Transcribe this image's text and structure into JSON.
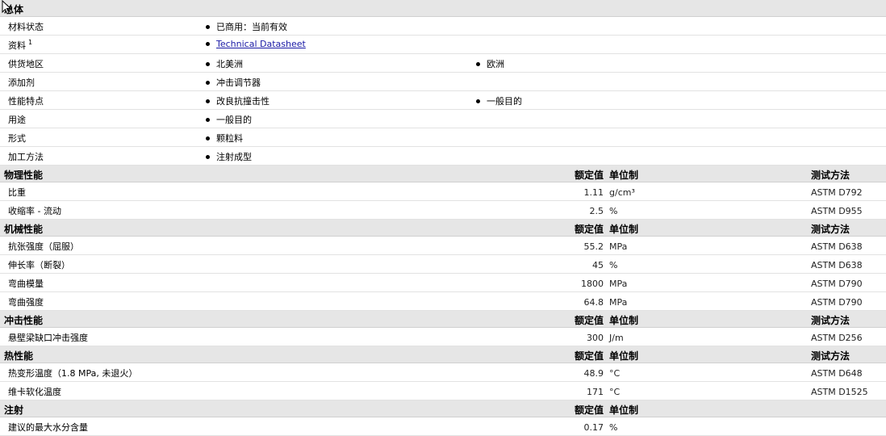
{
  "general": {
    "title": "总体",
    "rows": [
      {
        "label": "材料状态",
        "sup": "",
        "items": [
          "已商用：当前有效"
        ]
      },
      {
        "label": "资料",
        "sup": "1",
        "items": [
          "Technical Datasheet"
        ],
        "link": true
      },
      {
        "label": "供货地区",
        "sup": "",
        "items": [
          "北美洲",
          "欧洲"
        ]
      },
      {
        "label": "添加剂",
        "sup": "",
        "items": [
          "冲击调节器"
        ]
      },
      {
        "label": "性能特点",
        "sup": "",
        "items": [
          "改良抗撞击性",
          "一般目的"
        ]
      },
      {
        "label": "用途",
        "sup": "",
        "items": [
          "一般目的"
        ]
      },
      {
        "label": "形式",
        "sup": "",
        "items": [
          "颗粒料"
        ]
      },
      {
        "label": "加工方法",
        "sup": "",
        "items": [
          "注射成型"
        ]
      }
    ]
  },
  "headers": {
    "value": "额定值",
    "unit": "单位制",
    "method": "测试方法"
  },
  "sections": [
    {
      "title": "物理性能",
      "show_method": true,
      "rows": [
        {
          "label": "比重",
          "value": "1.11",
          "unit": "g/cm³",
          "method": "ASTM D792"
        },
        {
          "label": "收缩率 - 流动",
          "value": "2.5",
          "unit": "%",
          "method": "ASTM D955"
        }
      ]
    },
    {
      "title": "机械性能",
      "show_method": true,
      "rows": [
        {
          "label": "抗张强度（屈服）",
          "value": "55.2",
          "unit": "MPa",
          "method": "ASTM D638"
        },
        {
          "label": "伸长率（断裂）",
          "value": "45",
          "unit": "%",
          "method": "ASTM D638"
        },
        {
          "label": "弯曲模量",
          "value": "1800",
          "unit": "MPa",
          "method": "ASTM D790"
        },
        {
          "label": "弯曲强度",
          "value": "64.8",
          "unit": "MPa",
          "method": "ASTM D790"
        }
      ]
    },
    {
      "title": "冲击性能",
      "show_method": true,
      "rows": [
        {
          "label": "悬壁梁缺口冲击强度",
          "value": "300",
          "unit": "J/m",
          "method": "ASTM D256"
        }
      ]
    },
    {
      "title": "热性能",
      "show_method": true,
      "rows": [
        {
          "label": "热变形温度（1.8 MPa, 未退火）",
          "value": "48.9",
          "unit": "°C",
          "method": "ASTM D648"
        },
        {
          "label": "维卡软化温度",
          "value": "171",
          "unit": "°C",
          "method": "ASTM D1525"
        }
      ]
    },
    {
      "title": "注射",
      "show_method": false,
      "rows": [
        {
          "label": "建议的最大水分含量",
          "value": "0.17",
          "unit": "%",
          "method": ""
        }
      ]
    }
  ]
}
